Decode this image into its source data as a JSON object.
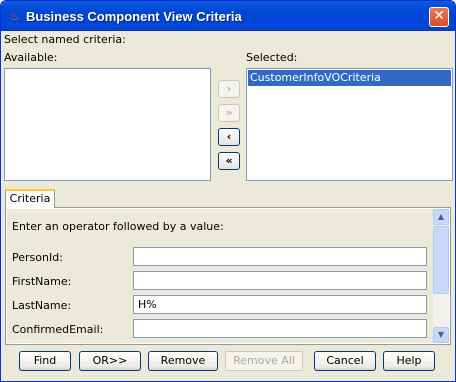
{
  "window": {
    "title": "Business Component View Criteria",
    "close_glyph": "✕",
    "icon": "java-icon",
    "icon_glyph": "♨"
  },
  "criteria_select": {
    "heading": "Select named criteria:",
    "available_label": "Available:",
    "selected_label": "Selected:",
    "available_items": [],
    "selected_items": [
      "CustomerInfoVOCriteria"
    ],
    "move_buttons": [
      {
        "glyph": "›",
        "enabled": false
      },
      {
        "glyph": "»",
        "enabled": false
      },
      {
        "glyph": "‹",
        "enabled": true
      },
      {
        "glyph": "«",
        "enabled": true
      }
    ]
  },
  "tabs": [
    {
      "label": "Criteria",
      "selected": true
    }
  ],
  "criteria": {
    "instruction": "Enter an operator followed by a value:",
    "fields": [
      {
        "label": "PersonId:",
        "value": ""
      },
      {
        "label": "FirstName:",
        "value": ""
      },
      {
        "label": "LastName:",
        "value": "H%"
      },
      {
        "label": "ConfirmedEmail:",
        "value": ""
      }
    ]
  },
  "buttons": {
    "find": "Find",
    "or": "OR>>",
    "remove": "Remove",
    "remove_all": "Remove All",
    "cancel": "Cancel",
    "help": "Help"
  },
  "colors": {
    "titlebar": "#0054e3",
    "selection": "#316ac5",
    "dialog_bg": "#ece9d8"
  }
}
